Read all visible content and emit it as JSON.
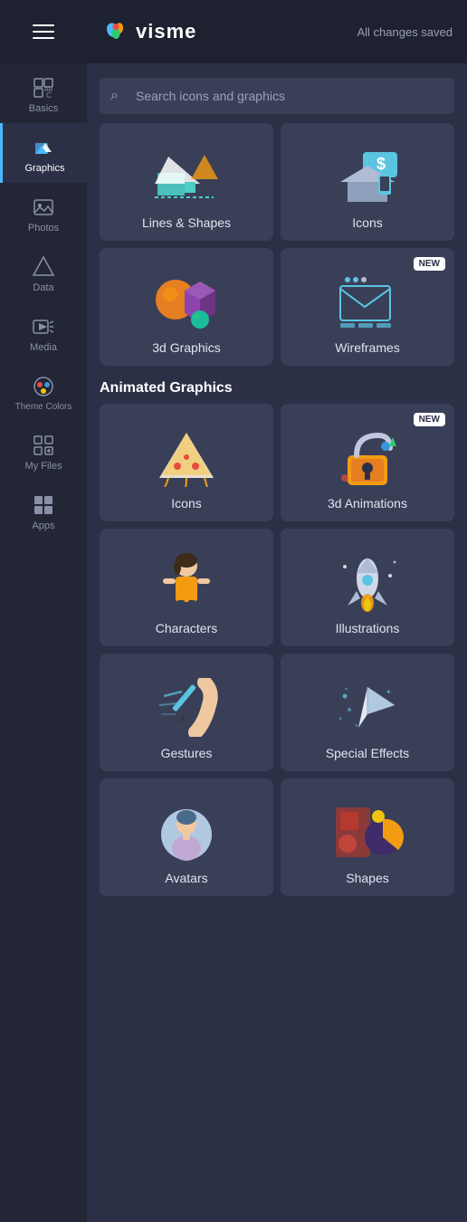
{
  "header": {
    "logo_text": "visme",
    "saved_text": "All changes saved"
  },
  "search": {
    "placeholder": "Search icons and graphics"
  },
  "sidebar": {
    "items": [
      {
        "id": "basics",
        "label": "Basics",
        "active": false
      },
      {
        "id": "graphics",
        "label": "Graphics",
        "active": true
      },
      {
        "id": "photos",
        "label": "Photos",
        "active": false
      },
      {
        "id": "data",
        "label": "Data",
        "active": false
      },
      {
        "id": "media",
        "label": "Media",
        "active": false
      },
      {
        "id": "theme-colors",
        "label": "Theme Colors",
        "active": false
      },
      {
        "id": "my-files",
        "label": "My Files",
        "active": false
      },
      {
        "id": "apps",
        "label": "Apps",
        "active": false
      }
    ]
  },
  "sections": {
    "static": {
      "items": [
        {
          "id": "lines-shapes",
          "label": "Lines & Shapes"
        },
        {
          "id": "icons",
          "label": "Icons"
        },
        {
          "id": "3d-graphics",
          "label": "3d Graphics"
        },
        {
          "id": "wireframes",
          "label": "Wireframes",
          "new": true
        }
      ]
    },
    "animated": {
      "title": "Animated Graphics",
      "items": [
        {
          "id": "anim-icons",
          "label": "Icons"
        },
        {
          "id": "3d-animations",
          "label": "3d Animations",
          "new": true
        },
        {
          "id": "characters",
          "label": "Characters"
        },
        {
          "id": "illustrations",
          "label": "Illustrations"
        },
        {
          "id": "gestures",
          "label": "Gestures"
        },
        {
          "id": "special-effects",
          "label": "Special Effects"
        },
        {
          "id": "avatars",
          "label": "Avatars"
        },
        {
          "id": "shapes",
          "label": "Shapes"
        }
      ]
    }
  }
}
